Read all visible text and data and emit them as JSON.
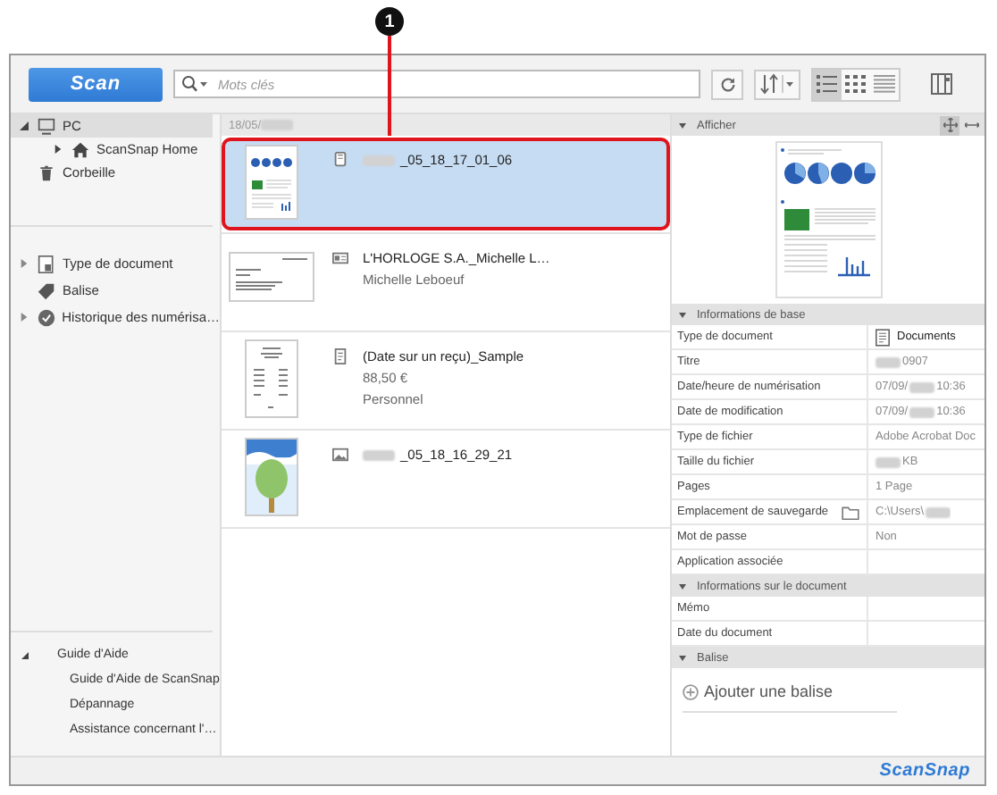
{
  "callout": {
    "number": "1"
  },
  "toolbar": {
    "scan_button": "Scan",
    "search": {
      "placeholder": "Mots clés"
    },
    "views": [
      {
        "kind": "list",
        "selected": true
      },
      {
        "kind": "grid",
        "selected": false
      },
      {
        "kind": "rows",
        "selected": false
      }
    ]
  },
  "sidebar": {
    "items": [
      {
        "label": "PC",
        "expanded": true,
        "selected": true,
        "children": [
          {
            "label": "ScanSnap Home",
            "expanded": false,
            "selected": false
          }
        ]
      },
      {
        "label": "Corbeille",
        "selected": false
      }
    ],
    "filters": [
      {
        "label": "Type de document",
        "expanded": false
      },
      {
        "label": "Balise"
      },
      {
        "label": "Historique des numérisa…",
        "expanded": false
      }
    ],
    "help": {
      "label": "Guide d'Aide",
      "expanded": true,
      "children": [
        "Guide d'Aide de ScanSnap",
        "Dépannage",
        "Assistance concernant l'…"
      ]
    }
  },
  "list": {
    "date_header": [
      {
        "kind": "text",
        "text": "18/05/"
      },
      {
        "kind": "blur"
      }
    ],
    "items": [
      {
        "kind": "document",
        "selected": true,
        "highlighted": true,
        "title": [
          {
            "kind": "blur"
          },
          {
            "kind": "text",
            "text": "_05_18_17_01_06"
          }
        ]
      },
      {
        "kind": "card",
        "selected": false,
        "highlighted": false,
        "title": [
          {
            "kind": "text",
            "text": "L'HORLOGE S.A._Michelle L…"
          }
        ],
        "details": [
          "Michelle Leboeuf"
        ]
      },
      {
        "kind": "receipt",
        "selected": false,
        "highlighted": false,
        "title": [
          {
            "kind": "text",
            "text": "(Date sur un reçu)_Sample"
          }
        ],
        "details": [
          "88,50 €",
          "Personnel"
        ]
      },
      {
        "kind": "photo",
        "selected": false,
        "highlighted": false,
        "title": [
          {
            "kind": "blur"
          },
          {
            "kind": "text",
            "text": "_05_18_16_29_21"
          }
        ]
      }
    ]
  },
  "details": {
    "preview_header": "Afficher",
    "sections": [
      {
        "title": "Informations de base",
        "rows": [
          {
            "label": "Type de document",
            "kind": "document-type",
            "value": [
              {
                "kind": "text",
                "text": "Documents"
              }
            ]
          },
          {
            "label": "Titre",
            "value": [
              {
                "kind": "blur"
              },
              {
                "kind": "text",
                "text": "0907"
              }
            ]
          },
          {
            "label": "Date/heure de numérisation",
            "value": [
              {
                "kind": "text",
                "text": "07/09/"
              },
              {
                "kind": "blur"
              },
              {
                "kind": "text",
                "text": "10:36"
              }
            ]
          },
          {
            "label": "Date de modification",
            "value": [
              {
                "kind": "text",
                "text": "07/09/"
              },
              {
                "kind": "blur"
              },
              {
                "kind": "text",
                "text": "10:36"
              }
            ]
          },
          {
            "label": "Type de fichier",
            "value": [
              {
                "kind": "text",
                "text": "Adobe Acrobat Doc"
              }
            ]
          },
          {
            "label": "Taille du fichier",
            "value": [
              {
                "kind": "blur"
              },
              {
                "kind": "text",
                "text": "KB"
              }
            ]
          },
          {
            "label": "Pages",
            "value": [
              {
                "kind": "text",
                "text": "1 Page"
              }
            ]
          },
          {
            "label": "Emplacement de sauvegarde",
            "kind": "location",
            "value": [
              {
                "kind": "text",
                "text": "C:\\Users\\"
              },
              {
                "kind": "blur"
              }
            ]
          },
          {
            "label": "Mot de passe",
            "value": [
              {
                "kind": "text",
                "text": "Non"
              }
            ]
          },
          {
            "label": "Application associée",
            "value": []
          }
        ]
      },
      {
        "title": "Informations sur le document",
        "rows": [
          {
            "label": "Mémo",
            "value": []
          },
          {
            "label": "Date du document",
            "value": []
          }
        ]
      },
      {
        "title": "Balise"
      }
    ],
    "add_tag": "Ajouter une balise"
  },
  "footer": {
    "logo": "ScanSnap"
  }
}
